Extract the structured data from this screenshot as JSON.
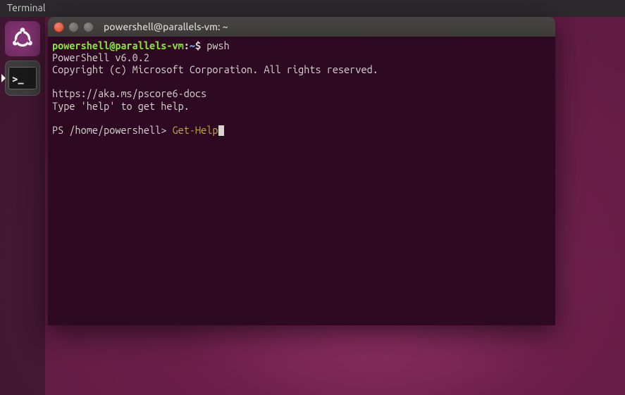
{
  "menubar": {
    "app_label": "Terminal"
  },
  "launcher": {
    "items": [
      {
        "name": "ubuntu-dash",
        "label": "Ubuntu"
      },
      {
        "name": "terminal-app",
        "label": "Terminal"
      }
    ]
  },
  "window": {
    "title": "powershell@parallels-vm: ~"
  },
  "terminal": {
    "bash_prompt": {
      "user_host": "powershell@parallels-vm",
      "sep": ":",
      "path": "~",
      "symbol": "$"
    },
    "bash_command": "pwsh",
    "output_lines": [
      "PowerShell v6.0.2",
      "Copyright (c) Microsoft Corporation. All rights reserved.",
      "",
      "https://aka.ms/pscore6-docs",
      "Type 'help' to get help.",
      ""
    ],
    "ps_prompt": "PS /home/powershell> ",
    "ps_command": "Get-Help"
  }
}
